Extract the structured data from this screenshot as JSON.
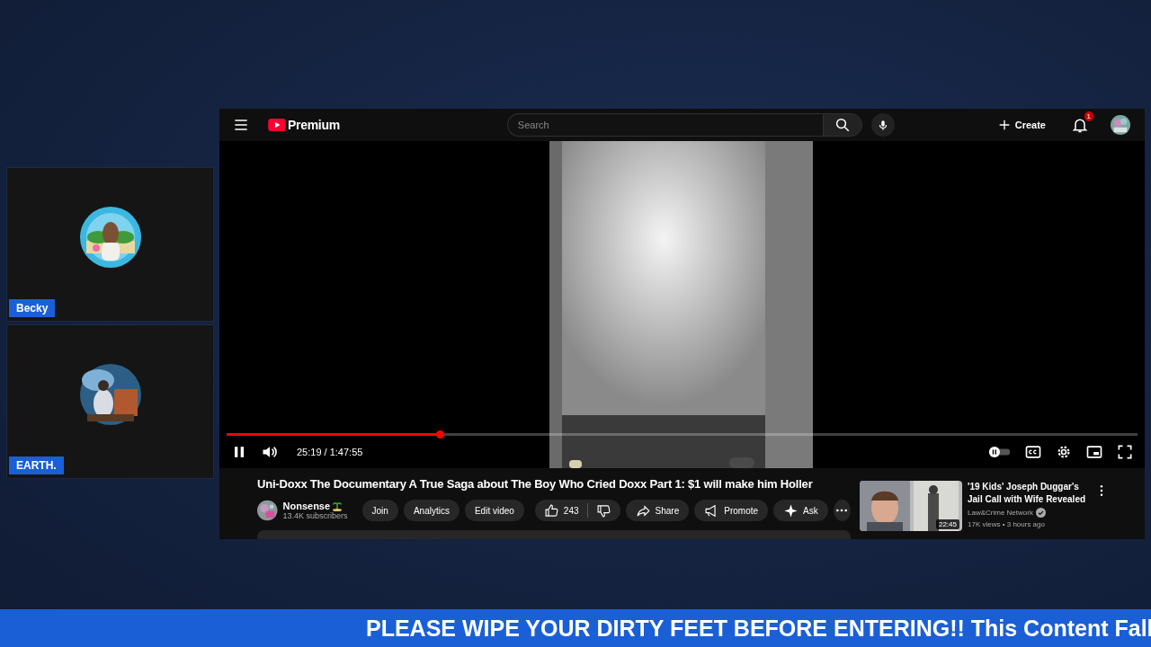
{
  "panels": [
    {
      "name": "Becky"
    },
    {
      "name": "EARTH."
    }
  ],
  "youtube": {
    "logo": "Premium",
    "search": {
      "placeholder": "Search"
    },
    "create": "Create",
    "notifications": "1",
    "player": {
      "level": 0.234,
      "time": "25:19 / 1:47:55"
    },
    "video": {
      "title": "Uni-Doxx The Documentary A True Saga about The Boy Who Cried Doxx Part 1: $1 will make him Holler",
      "channel": "Nonsense",
      "subscribers": "13.4K subscribers",
      "buttons": [
        "Join",
        "Analytics",
        "Edit video"
      ],
      "likes": "243",
      "actions": [
        {
          "kind": "share",
          "label": "Share"
        },
        {
          "kind": "promote",
          "label": "Promote"
        },
        {
          "kind": "ask",
          "label": "Ask"
        }
      ]
    },
    "recommended": [
      {
        "title": "'19 Kids' Joseph Duggar's Jail Call with Wife Revealed",
        "channel": "Law&Crime Network",
        "verified": true,
        "meta": "17K views • 3 hours ago",
        "duration": "22:45"
      }
    ]
  },
  "ticker": "PLEASE WIPE YOUR DIRTY FEET BEFORE ENTERING!! This Content Fall"
}
